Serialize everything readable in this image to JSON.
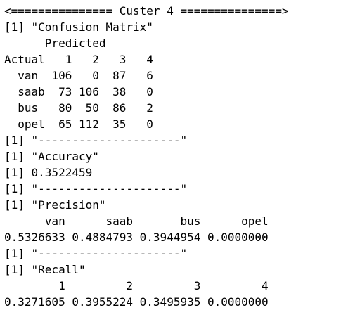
{
  "console": {
    "lines": [
      "<=============== Custer 4 ===============>",
      "[1] \"Confusion Matrix\"",
      "      Predicted",
      "Actual   1   2   3   4",
      "  van  106   0  87   6",
      "  saab  73 106  38   0",
      "  bus   80  50  86   2",
      "  opel  65 112  35   0",
      "[1] \"---------------------\"",
      "[1] \"Accuracy\"",
      "[1] 0.3522459",
      "[1] \"---------------------\"",
      "[1] \"Precision\"",
      "      van      saab       bus      opel",
      "0.5326633 0.4884793 0.3944954 0.0000000",
      "[1] \"---------------------\"",
      "[1] \"Recall\"",
      "        1         2         3         4",
      "0.3271605 0.3955224 0.3495935 0.0000000"
    ]
  }
}
